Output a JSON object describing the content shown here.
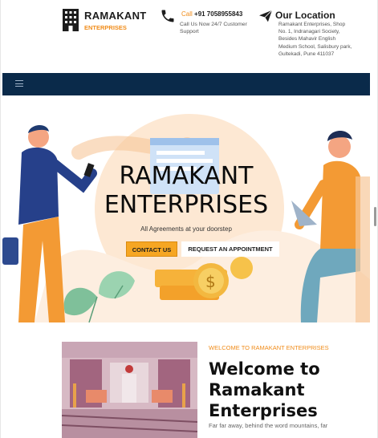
{
  "brand": {
    "name": "RAMAKANT",
    "sub": "ENTERPRISES"
  },
  "contact": {
    "call_label": "Call",
    "phone": "+91 7058955843",
    "call_sub": "Call Us Now 24/7 Customer Support"
  },
  "location": {
    "title": "Our Location",
    "address": "Ramakant Enterprises, Shop No. 1, Indranagari Society, Besides Mahavir English Medium School, Salisbury park, Gultekadi, Pune 411037"
  },
  "nav": {
    "menu_icon": "hamburger-menu-icon"
  },
  "hero": {
    "title_line1": "RAMAKANT",
    "title_line2": "ENTERPRISES",
    "subtitle": "All Agreements at your doorstep",
    "contact_button": "CONTACT US",
    "appointment_button": "REQUEST AN APPOINTMENT"
  },
  "welcome": {
    "kicker": "WELCOME TO RAMAKANT ENTERPRISES",
    "title_line1": "Welcome to",
    "title_line2": "Ramakant",
    "title_line3": "Enterprises",
    "text": "Far far away, behind the word mountains, far"
  },
  "colors": {
    "accent": "#f08c1a",
    "nav": "#0a2a4a",
    "button": "#f6a623"
  }
}
